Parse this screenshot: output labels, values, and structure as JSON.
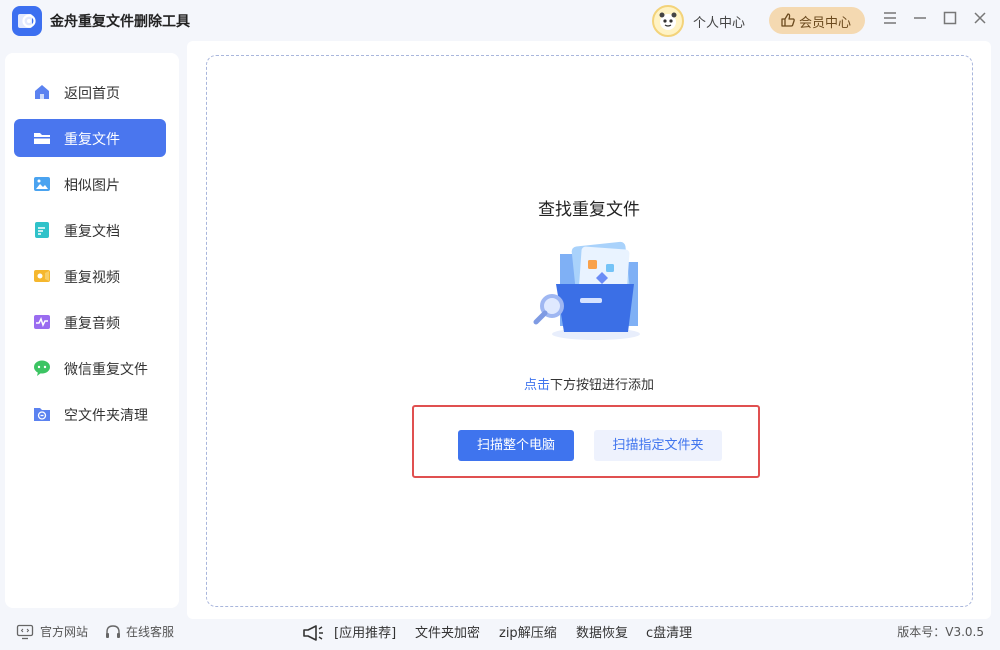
{
  "app": {
    "title": "金舟重复文件删除工具"
  },
  "header": {
    "user_center": "个人中心",
    "vip_center": "会员中心"
  },
  "sidebar": {
    "items": [
      {
        "label": "返回首页",
        "icon": "home-icon"
      },
      {
        "label": "重复文件",
        "icon": "folder-icon",
        "active": true
      },
      {
        "label": "相似图片",
        "icon": "image-icon"
      },
      {
        "label": "重复文档",
        "icon": "document-icon"
      },
      {
        "label": "重复视频",
        "icon": "video-icon"
      },
      {
        "label": "重复音频",
        "icon": "audio-icon"
      },
      {
        "label": "微信重复文件",
        "icon": "wechat-icon"
      },
      {
        "label": "空文件夹清理",
        "icon": "empty-folder-icon"
      }
    ]
  },
  "main": {
    "title": "查找重复文件",
    "hint_link": "点击",
    "hint_rest": "下方按钮进行添加",
    "scan_all_label": "扫描整个电脑",
    "scan_folder_label": "扫描指定文件夹"
  },
  "footer": {
    "official_site": "官方网站",
    "online_service": "在线客服",
    "recommend_label": "[应用推荐]",
    "links": [
      "文件夹加密",
      "zip解压缩",
      "数据恢复",
      "c盘清理"
    ],
    "version": "版本号：V3.0.5"
  },
  "colors": {
    "accent": "#4a76ee",
    "highlight_border": "#e05050",
    "vip": "#f4d9b1"
  }
}
